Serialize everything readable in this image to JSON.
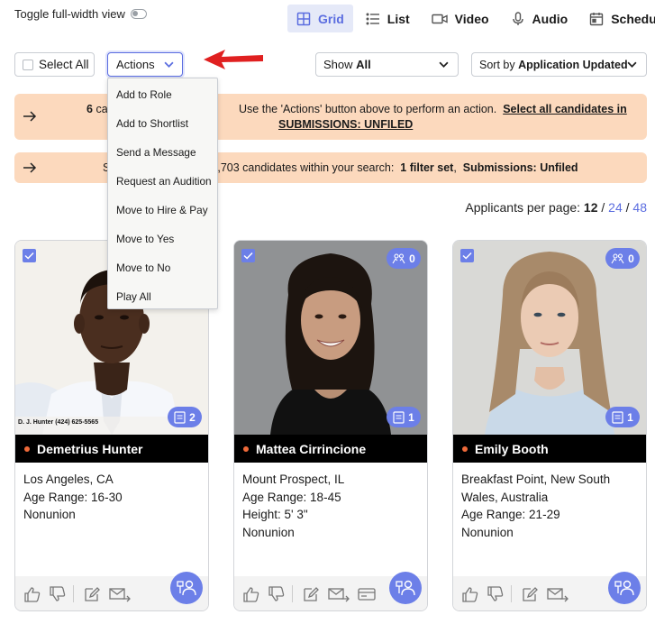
{
  "header": {
    "toggle_label": "Toggle full-width view",
    "tabs": [
      {
        "label": "Grid",
        "icon": "grid-icon",
        "active": true
      },
      {
        "label": "List",
        "icon": "list-icon",
        "active": false
      },
      {
        "label": "Video",
        "icon": "video-icon",
        "active": false
      },
      {
        "label": "Audio",
        "icon": "microphone-icon",
        "active": false
      },
      {
        "label": "Schedule",
        "icon": "calendar-icon",
        "active": false
      }
    ]
  },
  "controls": {
    "select_all_label": "Select All",
    "actions_label": "Actions",
    "show_prefix": "Show",
    "show_value": "All",
    "sort_prefix": "Sort by",
    "sort_value": "Application Updated"
  },
  "actions_menu": {
    "items": [
      "Add to Role",
      "Add to Shortlist",
      "Send a Message",
      "Request an Audition",
      "Move to Hire & Pay",
      "Move to Yes",
      "Move to No",
      "Play All"
    ]
  },
  "banners": {
    "b1_count": "6",
    "b1_text_visible": "cand",
    "b1_text_after": "Use the 'Actions' button above to perform an action.",
    "b1_link_line1": "Select all candidates in",
    "b1_link_line2": "SUBMISSIONS: UNFILED",
    "b2_prefix": "S",
    "b2_count": ",703",
    "b2_text": "candidates within your search:",
    "b2_filter": "1 filter set",
    "b2_submissions": "Submissions: Unfiled"
  },
  "pagination": {
    "label": "Applicants per page:",
    "current": "12",
    "options": [
      "24",
      "48"
    ],
    "separator": "/"
  },
  "candidates": [
    {
      "name": "Demetrius Hunter",
      "location": "Los Angeles, CA",
      "age_range": "Age Range: 16-30",
      "height": "",
      "union": "Nonunion",
      "media_count": "2",
      "role_count": "",
      "photo_caption": "D. J. Hunter (424) 625-5565"
    },
    {
      "name": "Mattea Cirrincione",
      "location": "Mount Prospect, IL",
      "age_range": "Age Range: 18-45",
      "height": "Height: 5' 3\"",
      "union": "Nonunion",
      "media_count": "1",
      "role_count": "0",
      "photo_caption": ""
    },
    {
      "name": "Emily Booth",
      "location": "Breakfast Point, New South Wales, Australia",
      "age_range": "Age Range: 21-29",
      "height": "",
      "union": "Nonunion",
      "media_count": "1",
      "role_count": "0",
      "photo_caption": ""
    }
  ],
  "colors": {
    "accent": "#5b6de0",
    "pill": "#6c7fe8",
    "banner": "#fcd9bd",
    "arrow": "#e02020",
    "status_dot": "#ef6a3a"
  }
}
